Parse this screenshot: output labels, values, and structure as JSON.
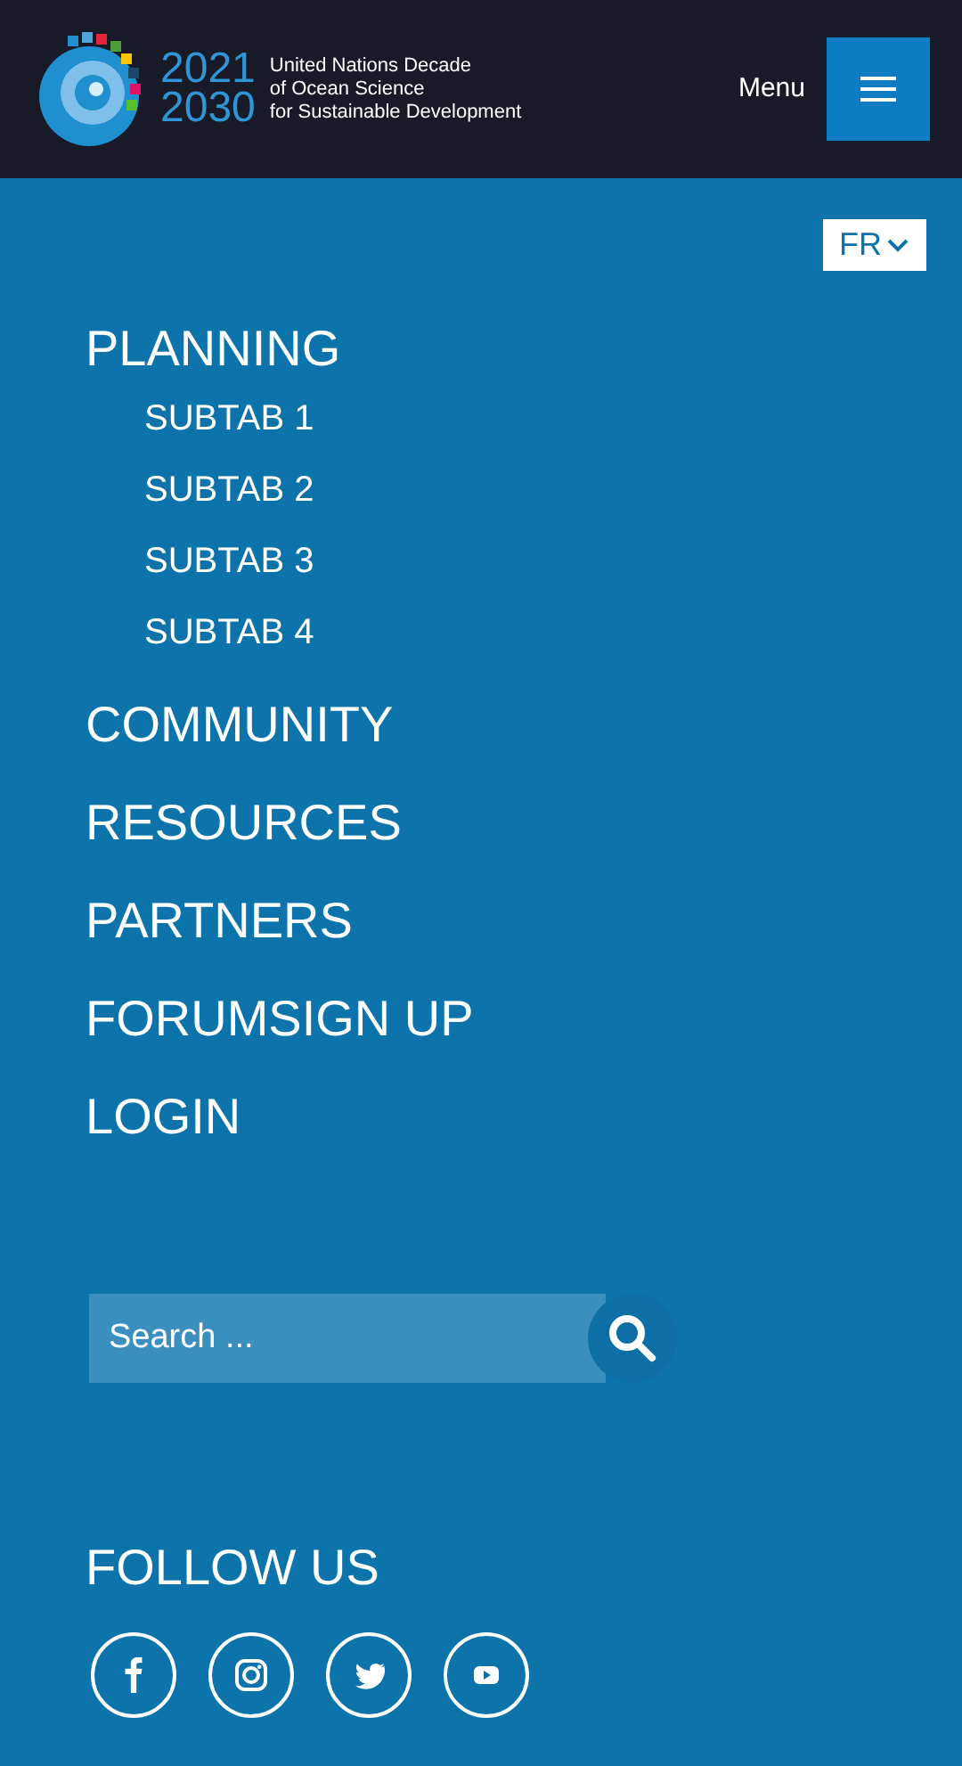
{
  "header": {
    "logo": {
      "years": [
        "2021",
        "2030"
      ],
      "lines": [
        "United Nations Decade",
        "of Ocean Science",
        "for Sustainable Development"
      ]
    },
    "menu_label": "Menu"
  },
  "language": {
    "label": "FR"
  },
  "nav": [
    {
      "label": "PLANNING",
      "children": [
        {
          "label": "SUBTAB 1"
        },
        {
          "label": "SUBTAB 2"
        },
        {
          "label": "SUBTAB 3"
        },
        {
          "label": "SUBTAB 4"
        }
      ]
    },
    {
      "label": "COMMUNITY"
    },
    {
      "label": "RESOURCES"
    },
    {
      "label": "PARTNERS"
    },
    {
      "label": "FORUMSIGN UP"
    },
    {
      "label": "LOGIN"
    }
  ],
  "search": {
    "placeholder": "Search ..."
  },
  "follow": {
    "title": "FOLLOW US",
    "links": [
      {
        "kind": "facebook"
      },
      {
        "kind": "instagram"
      },
      {
        "kind": "twitter"
      },
      {
        "kind": "youtube"
      }
    ]
  }
}
